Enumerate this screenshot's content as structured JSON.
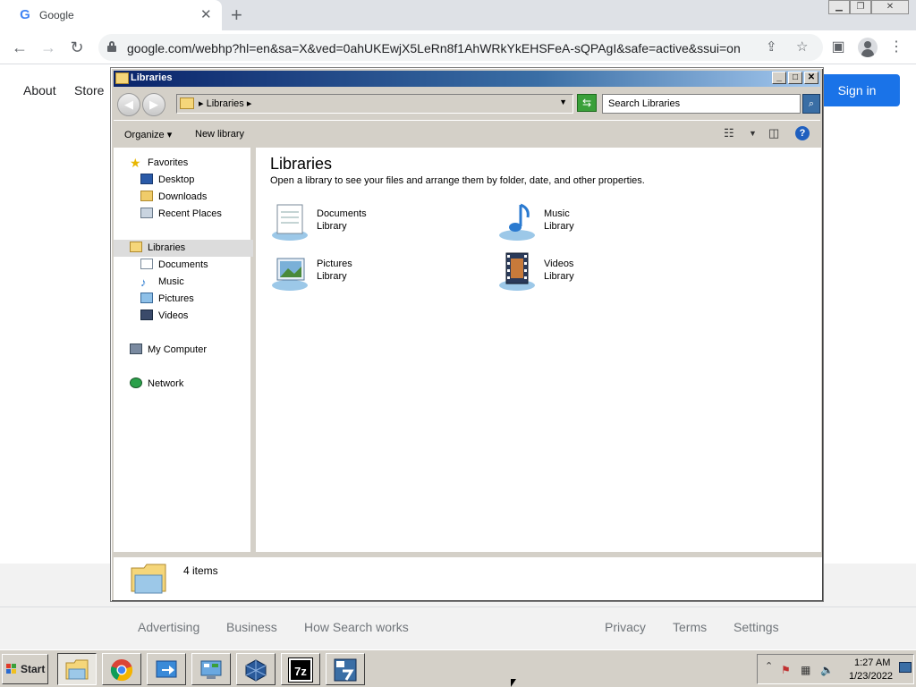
{
  "browser": {
    "tab_title": "Google",
    "tab_favicon": "G",
    "url": "google.com/webhp?hl=en&sa=X&ved=0ahUKEwjX5LeRn8f1AhWRkYkEHSFeA-sQPAgI&safe=active&ssui=on",
    "icons": [
      "back-icon",
      "forward-icon",
      "reload-icon",
      "lock-icon",
      "share-icon",
      "bookmark-star-icon",
      "side-panel-icon",
      "profile-icon",
      "menu-icon"
    ]
  },
  "google": {
    "about": "About",
    "store": "Store",
    "signin": "Sign in",
    "accent": "#1a73e8",
    "footer": {
      "advertising": "Advertising",
      "business": "Business",
      "how_search_works": "How Search works",
      "privacy": "Privacy",
      "terms": "Terms",
      "settings": "Settings"
    }
  },
  "explorer": {
    "title": "Libraries",
    "address": "Libraries",
    "search_placeholder": "Search Libraries",
    "organize": "Organize",
    "new_library": "New library",
    "nav": {
      "favorites": "Favorites",
      "desktop": "Desktop",
      "downloads": "Downloads",
      "recent_places": "Recent Places",
      "libraries": "Libraries",
      "documents": "Documents",
      "music": "Music",
      "pictures": "Pictures",
      "videos": "Videos",
      "my_computer": "My Computer",
      "network": "Network"
    },
    "content_title": "Libraries",
    "content_desc": "Open a library to see your files and arrange them by folder, date, and other properties.",
    "libraries": [
      {
        "name": "Documents",
        "sub": "Library"
      },
      {
        "name": "Music",
        "sub": "Library"
      },
      {
        "name": "Pictures",
        "sub": "Library"
      },
      {
        "name": "Videos",
        "sub": "Library"
      }
    ],
    "item_count": "4 items"
  },
  "taskbar": {
    "start": "Start",
    "apps": [
      "explorer-icon",
      "chrome-icon",
      "remote-desktop-icon",
      "control-panel-icon",
      "virtualbox-icon",
      "7zip-icon",
      "7zip-64-icon"
    ],
    "sevenzip_label": "7z",
    "time": "1:27 AM",
    "date": "1/23/2022"
  }
}
